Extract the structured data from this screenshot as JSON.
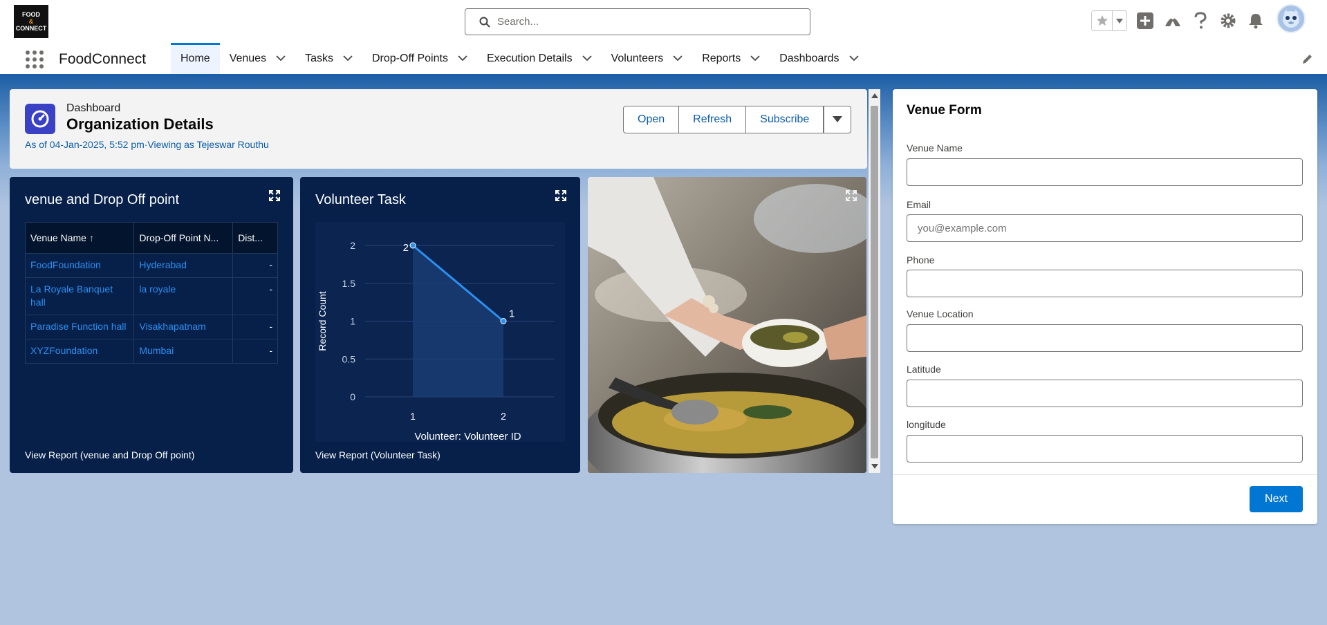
{
  "header": {
    "logo": {
      "line1": "FOOD",
      "amp": "&",
      "line2": "CONNECT"
    },
    "search": {
      "placeholder": "Search..."
    },
    "icons": [
      "star-icon",
      "chevron-down-icon",
      "add-icon",
      "trailhead-icon",
      "help-icon",
      "gear-icon",
      "bell-icon",
      "avatar-icon"
    ]
  },
  "nav": {
    "app_name": "FoodConnect",
    "tabs": [
      {
        "label": "Home",
        "active": true,
        "has_menu": false
      },
      {
        "label": "Venues",
        "has_menu": true
      },
      {
        "label": "Tasks",
        "has_menu": true
      },
      {
        "label": "Drop-Off Points",
        "has_menu": true
      },
      {
        "label": "Execution Details",
        "has_menu": true
      },
      {
        "label": "Volunteers",
        "has_menu": true
      },
      {
        "label": "Reports",
        "has_menu": true
      },
      {
        "label": "Dashboards",
        "has_menu": true
      }
    ]
  },
  "dashboard": {
    "type_label": "Dashboard",
    "title": "Organization Details",
    "subtitle": "As of 04-Jan-2025, 5:52 pm·Viewing as Tejeswar Routhu",
    "buttons": {
      "open": "Open",
      "refresh": "Refresh",
      "subscribe": "Subscribe"
    }
  },
  "widget_table": {
    "title": "venue and Drop Off point",
    "columns": [
      "Venue Name",
      "Drop-Off Point N...",
      "Dist..."
    ],
    "sort_indicator": "↑",
    "rows": [
      {
        "venue": "FoodFoundation",
        "dropoff": "Hyderabad",
        "dist": "-"
      },
      {
        "venue": "La Royale Banquet hall",
        "dropoff": "la royale",
        "dist": "-"
      },
      {
        "venue": "Paradise Function hall",
        "dropoff": "Visakhapatnam",
        "dist": "-"
      },
      {
        "venue": "XYZFoundation",
        "dropoff": "Mumbai",
        "dist": "-"
      }
    ],
    "footer": "View Report (venue and Drop Off point)"
  },
  "widget_chart": {
    "title": "Volunteer Task",
    "footer": "View Report (Volunteer Task)"
  },
  "chart_data": {
    "type": "line",
    "x": [
      "1",
      "2"
    ],
    "series": [
      {
        "values": [
          2,
          1
        ]
      }
    ],
    "xlabel": "Volunteer: Volunteer ID",
    "ylabel": "Record Count",
    "y_ticks": [
      "0",
      "0.5",
      "1",
      "1.5",
      "2"
    ],
    "ylim": [
      0,
      2
    ],
    "data_labels": [
      "2",
      "1"
    ],
    "grid": true,
    "colors": {
      "line": "#2b8ff0",
      "fill": "#1a3d73"
    }
  },
  "form": {
    "title": "Venue Form",
    "fields": [
      {
        "label": "Venue Name",
        "value": "",
        "placeholder": ""
      },
      {
        "label": "Email",
        "value": "",
        "placeholder": "you@example.com"
      },
      {
        "label": "Phone",
        "value": "",
        "placeholder": ""
      },
      {
        "label": "Venue Location",
        "value": "",
        "placeholder": ""
      },
      {
        "label": "Latitude",
        "value": "",
        "placeholder": ""
      },
      {
        "label": "longitude",
        "value": "",
        "placeholder": ""
      }
    ],
    "next_label": "Next"
  },
  "colors": {
    "brand": "#0176d3",
    "nav_accent": "#1b5faa",
    "widget_bg": "#06204a",
    "link": "#0b5cab",
    "dashboard_icon": "#3b41c5"
  }
}
